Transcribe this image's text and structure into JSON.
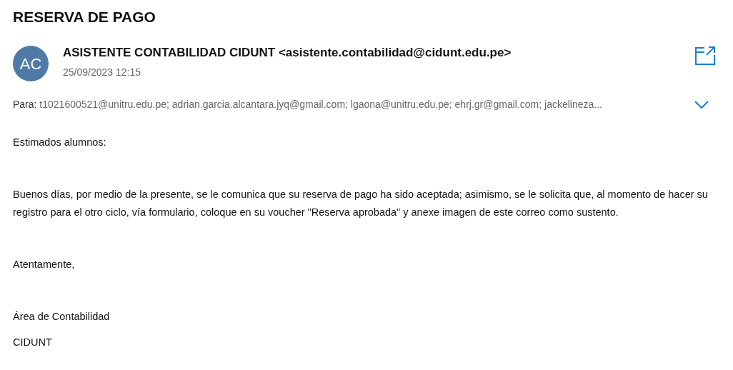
{
  "subject": "RESERVA DE PAGO",
  "sender": {
    "initials": "AC",
    "name": "ASISTENTE CONTABILIDAD CIDUNT <asistente.contabilidad@cidunt.edu.pe>",
    "date": "25/09/2023 12:15"
  },
  "recipients": {
    "label": "Para:",
    "value": "t1021600521@unitru.edu.pe; adrian.garcia.alcantara.jyq@gmail.com; lgaona@unitru.edu.pe; ehrj.gr@gmail.com; jackelineza...",
    "expanded": false
  },
  "body": [
    {
      "text": "Estimados alumnos:"
    },
    {
      "text": "Buenos días, por medio de la presente, se le comunica que su reserva de pago ha sido aceptada; asimismo, se le solicita que, al momento de hacer su registro para el otro ciclo, vía formulario, coloque en su voucher \"Reserva aprobada\" y anexe imagen de este correo como sustento."
    },
    {
      "text": "Atentamente,"
    },
    {
      "text": "Área de Contabilidad"
    },
    {
      "text": "CIDUNT"
    }
  ]
}
